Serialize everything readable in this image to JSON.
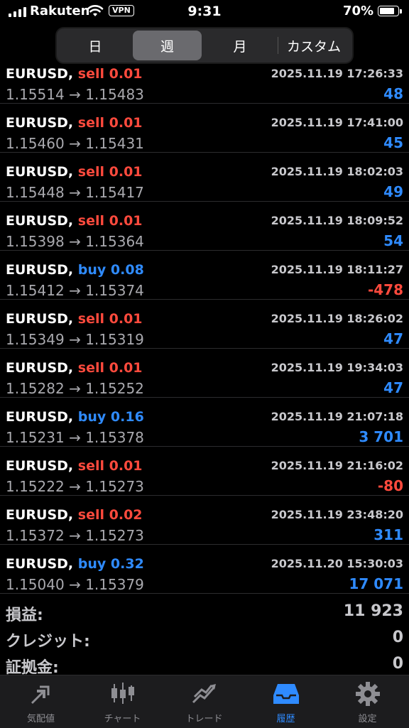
{
  "status_bar": {
    "carrier": "Rakuten",
    "vpn": "VPN",
    "time": "9:31",
    "battery": "70%"
  },
  "period_tabs": [
    {
      "label": "日",
      "active": false
    },
    {
      "label": "週",
      "active": true
    },
    {
      "label": "月",
      "active": false
    },
    {
      "label": "カスタム",
      "active": false
    }
  ],
  "trades": [
    {
      "symbol": "EURUSD,",
      "side": "sell",
      "volume": "0.01",
      "time": "2025.11.19 17:26:33",
      "open": "1.15514",
      "close": "1.15483",
      "profit": "48"
    },
    {
      "symbol": "EURUSD,",
      "side": "sell",
      "volume": "0.01",
      "time": "2025.11.19 17:41:00",
      "open": "1.15460",
      "close": "1.15431",
      "profit": "45"
    },
    {
      "symbol": "EURUSD,",
      "side": "sell",
      "volume": "0.01",
      "time": "2025.11.19 18:02:03",
      "open": "1.15448",
      "close": "1.15417",
      "profit": "49"
    },
    {
      "symbol": "EURUSD,",
      "side": "sell",
      "volume": "0.01",
      "time": "2025.11.19 18:09:52",
      "open": "1.15398",
      "close": "1.15364",
      "profit": "54"
    },
    {
      "symbol": "EURUSD,",
      "side": "buy",
      "volume": "0.08",
      "time": "2025.11.19 18:11:27",
      "open": "1.15412",
      "close": "1.15374",
      "profit": "-478"
    },
    {
      "symbol": "EURUSD,",
      "side": "sell",
      "volume": "0.01",
      "time": "2025.11.19 18:26:02",
      "open": "1.15349",
      "close": "1.15319",
      "profit": "47"
    },
    {
      "symbol": "EURUSD,",
      "side": "sell",
      "volume": "0.01",
      "time": "2025.11.19 19:34:03",
      "open": "1.15282",
      "close": "1.15252",
      "profit": "47"
    },
    {
      "symbol": "EURUSD,",
      "side": "buy",
      "volume": "0.16",
      "time": "2025.11.19 21:07:18",
      "open": "1.15231",
      "close": "1.15378",
      "profit": "3 701"
    },
    {
      "symbol": "EURUSD,",
      "side": "sell",
      "volume": "0.01",
      "time": "2025.11.19 21:16:02",
      "open": "1.15222",
      "close": "1.15273",
      "profit": "-80"
    },
    {
      "symbol": "EURUSD,",
      "side": "sell",
      "volume": "0.02",
      "time": "2025.11.19 23:48:20",
      "open": "1.15372",
      "close": "1.15273",
      "profit": "311"
    },
    {
      "symbol": "EURUSD,",
      "side": "buy",
      "volume": "0.32",
      "time": "2025.11.20 15:30:03",
      "open": "1.15040",
      "close": "1.15379",
      "profit": "17 071"
    }
  ],
  "summary": [
    {
      "label": "損益:",
      "value": "11 923"
    },
    {
      "label": "クレジット:",
      "value": "0"
    },
    {
      "label": "証拠金:",
      "value": "0"
    }
  ],
  "tab_bar": [
    {
      "label": "気配値",
      "icon": "quotes-icon",
      "active": false
    },
    {
      "label": "チャート",
      "icon": "chart-icon",
      "active": false
    },
    {
      "label": "トレード",
      "icon": "trade-icon",
      "active": false
    },
    {
      "label": "履歴",
      "icon": "history-icon",
      "active": true
    },
    {
      "label": "設定",
      "icon": "settings-icon",
      "active": false
    }
  ],
  "colors": {
    "sell": "#ff4a3d",
    "buy": "#2f8bff",
    "active_tab": "#2f8bff"
  }
}
